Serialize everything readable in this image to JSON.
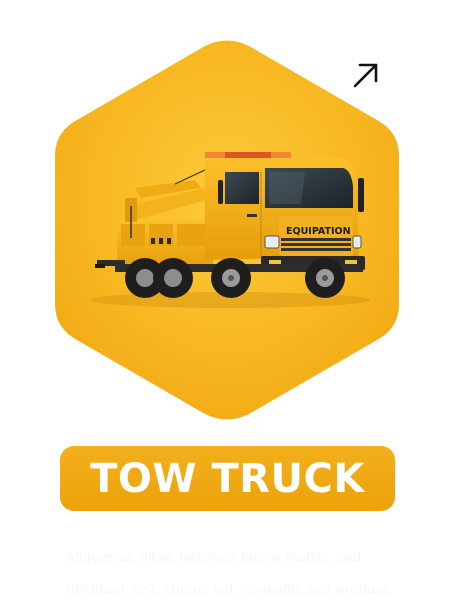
{
  "card": {
    "title": "TOW TRUCK",
    "description": "Aliquet ac vitae faucibus lorem mattis, sed tincidunt nisi, cursus vel, convallis sed pretium, adipiscing nec eget.",
    "truck_brand": "EQUIPATION"
  },
  "link": {
    "icon": "arrow-up-right-icon"
  },
  "colors": {
    "accent": "#f0a80f",
    "hexagon": "#f5b820",
    "title_text": "#ffffff",
    "truck_body": "#f7b51a"
  }
}
